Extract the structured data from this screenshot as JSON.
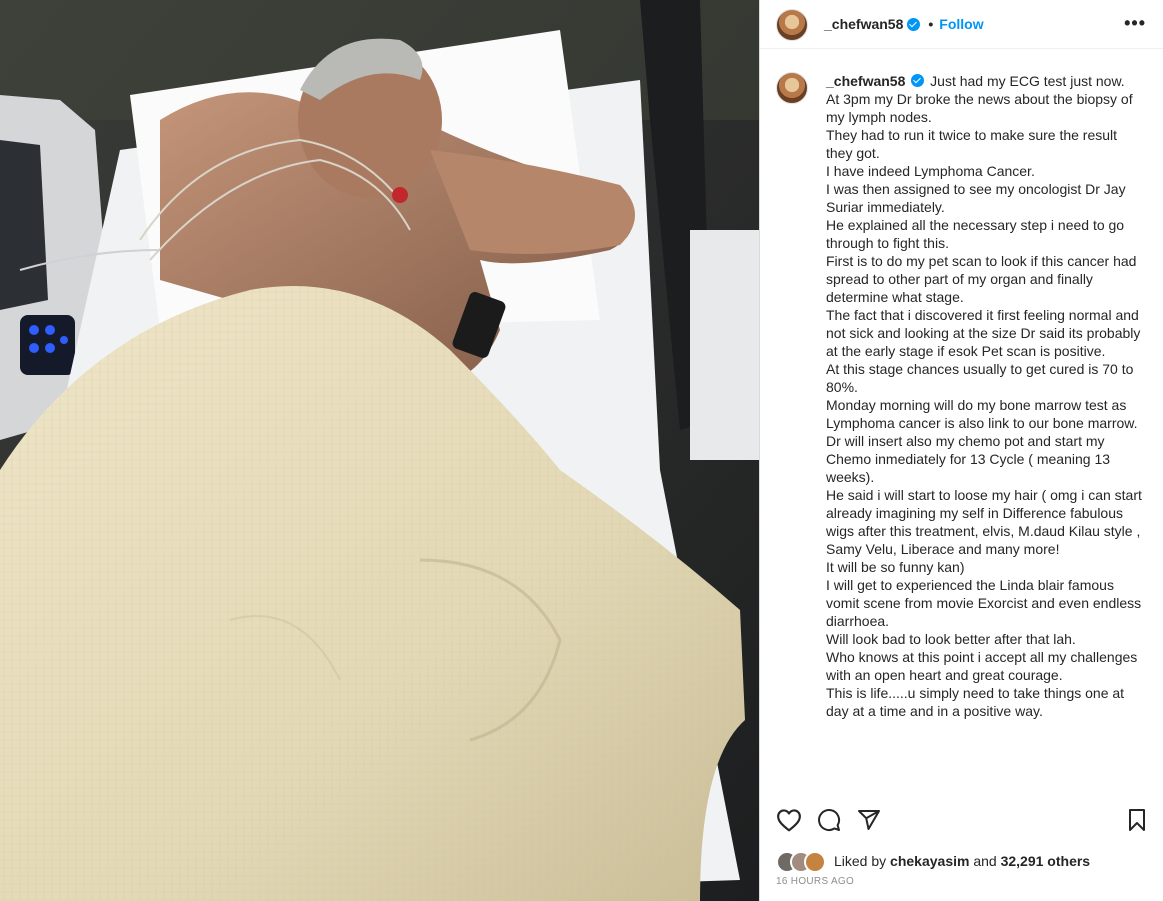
{
  "post": {
    "username": "_chefwan58",
    "follow_label": "Follow",
    "separator": "•",
    "more_label": "•••"
  },
  "caption": {
    "username": "_chefwan58",
    "lines": [
      "Just had my ECG test just now.",
      "At 3pm my Dr broke the news about the biopsy of my lymph nodes.",
      "They had to run it twice to make sure the result they got.",
      "I have indeed Lymphoma Cancer.",
      "I was then assigned to see my oncologist Dr Jay Suriar immediately.",
      "He explained all the necessary step i need to go through to fight this.",
      "First is to do my pet scan to look if this cancer had spread to other part of my organ and finally determine what stage.",
      "The fact that i discovered it first feeling normal and not sick and looking at the size Dr said its probably at the early stage if esok Pet scan is positive.",
      "At this stage chances usually to get cured is 70 to 80%.",
      "Monday morning will do my bone marrow test as Lymphoma cancer is also link to our bone marrow.",
      "Dr will insert also my chemo pot and start my Chemo inmediately for 13 Cycle ( meaning 13 weeks).",
      "He said i will start to loose my hair ( omg i can start already imagining my self in Difference fabulous wigs after this treatment, elvis, M.daud Kilau style , Samy Velu, Liberace and many more!",
      "It will be so funny kan)",
      "I will get to experienced the Linda blair famous vomit scene from movie Exorcist and even endless diarrhoea.",
      "Will look bad to look better after that lah.",
      "Who knows at this point i accept all my challenges with an open heart and great courage.",
      "This is life.....u simply need to take things one at day at a time and in a positive way."
    ]
  },
  "likes": {
    "prefix": "Liked by ",
    "first_liker": "chekayasim",
    "middle": " and ",
    "count_text": "32,291 others"
  },
  "timestamp": "16 HOURS AGO",
  "icons": {
    "like": "heart-icon",
    "comment": "comment-icon",
    "share": "share-icon",
    "save": "bookmark-icon",
    "verified": "verified-badge-icon"
  },
  "colors": {
    "link_blue": "#0095f6",
    "text": "#262626",
    "muted": "#8e8e8e"
  }
}
